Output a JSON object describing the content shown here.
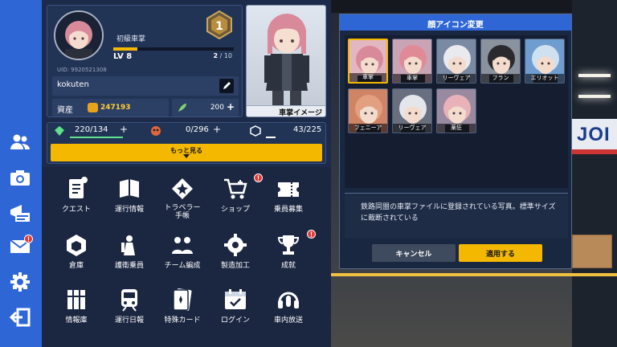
{
  "profile": {
    "rank_label": "初級車掌",
    "level": "LV 8",
    "xp_current": "2",
    "xp_max": "/ 10",
    "xp_fraction": 0.2,
    "uid": "UID: 9920521308",
    "name": "kokuten",
    "asset_label": "資産",
    "asset_value": "247193",
    "gem_value": "200",
    "badge_number": "1"
  },
  "portrait": {
    "caption": "車掌イメージ"
  },
  "resources": [
    {
      "value": "220/134",
      "icon": "gem-icon"
    },
    {
      "value": "0/296",
      "icon": "skull-icon"
    },
    {
      "value": "43/225",
      "icon": "cube-icon"
    }
  ],
  "more_button": "もっと見る",
  "menu": [
    {
      "label": "クエスト",
      "icon": "quest-icon",
      "alert": false
    },
    {
      "label": "運行情報",
      "icon": "book-icon",
      "alert": false
    },
    {
      "label": "トラベラー\n手帳",
      "icon": "star-icon",
      "alert": false
    },
    {
      "label": "ショップ",
      "icon": "cart-icon",
      "alert": true
    },
    {
      "label": "乗員募集",
      "icon": "ticket-icon",
      "alert": false
    },
    {
      "label": "倉庫",
      "icon": "warehouse-icon",
      "alert": false
    },
    {
      "label": "護衛乗員",
      "icon": "guard-icon",
      "alert": false
    },
    {
      "label": "チーム編成",
      "icon": "team-icon",
      "alert": false
    },
    {
      "label": "製造加工",
      "icon": "gear-icon",
      "alert": false
    },
    {
      "label": "成就",
      "icon": "trophy-icon",
      "alert": true
    },
    {
      "label": "情報庫",
      "icon": "archive-icon",
      "alert": false
    },
    {
      "label": "運行日報",
      "icon": "train-icon",
      "alert": false
    },
    {
      "label": "特殊カード",
      "icon": "card-icon",
      "alert": false
    },
    {
      "label": "ログイン",
      "icon": "calendar-icon",
      "alert": false
    },
    {
      "label": "車内放送",
      "icon": "headset-icon",
      "alert": false
    }
  ],
  "rail": [
    {
      "icon": "friends-icon",
      "alert": false
    },
    {
      "icon": "camera-icon",
      "alert": false
    },
    {
      "icon": "announcement-icon",
      "alert": false
    },
    {
      "icon": "mail-icon",
      "alert": true
    },
    {
      "icon": "settings-icon",
      "alert": false
    },
    {
      "icon": "exit-icon",
      "alert": false
    }
  ],
  "dialog": {
    "title": "顔アイコン変更",
    "faces": [
      {
        "name": "車掌",
        "selected": true,
        "hair": "#d98a9a",
        "bg": "#e3b7c1"
      },
      {
        "name": "車掌",
        "selected": false,
        "hair": "#e08a98",
        "bg": "#c9a4b4"
      },
      {
        "name": "リーヴェア",
        "selected": false,
        "hair": "#e8eaef",
        "bg": "#7a8aa2"
      },
      {
        "name": "フラン",
        "selected": false,
        "hair": "#2a2a2e",
        "bg": "#8a929e"
      },
      {
        "name": "エリオット",
        "selected": false,
        "hair": "#cfe0f0",
        "bg": "#6f9dcf"
      },
      {
        "name": "フェニーア",
        "selected": false,
        "hair": "#e2a080",
        "bg": "#d08466"
      },
      {
        "name": "リーヴェア",
        "selected": false,
        "hair": "#e4e6ec",
        "bg": "#6a6f80"
      },
      {
        "name": "薬狂",
        "selected": false,
        "hair": "#e8b2b8",
        "bg": "#9a8aa0"
      }
    ],
    "description": "鉄路同盟の車掌ファイルに登録されている写真。標準サイズに裁断されている",
    "cancel": "キャンセル",
    "apply": "適用する"
  },
  "scene": {
    "sign_text": "JOI"
  },
  "colors": {
    "accent": "#f5b800",
    "rail": "#2f66d6",
    "alert": "#e53636"
  }
}
